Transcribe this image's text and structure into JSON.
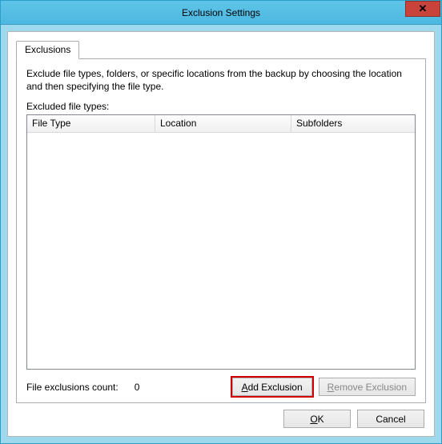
{
  "window": {
    "title": "Exclusion Settings",
    "close_glyph": "✕"
  },
  "tab": {
    "label": "Exclusions"
  },
  "panel": {
    "description": "Exclude file types, folders, or specific locations from the backup by choosing the location and then specifying the file type.",
    "list_label": "Excluded file types:",
    "columns": {
      "filetype": "File Type",
      "location": "Location",
      "subfolders": "Subfolders"
    },
    "rows": []
  },
  "count": {
    "label": "File exclusions count:",
    "value": "0"
  },
  "buttons": {
    "add_prefix": "A",
    "add_rest": "dd Exclusion",
    "remove_prefix": "R",
    "remove_rest": "emove Exclusion",
    "ok_prefix": "O",
    "ok_rest": "K",
    "cancel": "Cancel"
  }
}
